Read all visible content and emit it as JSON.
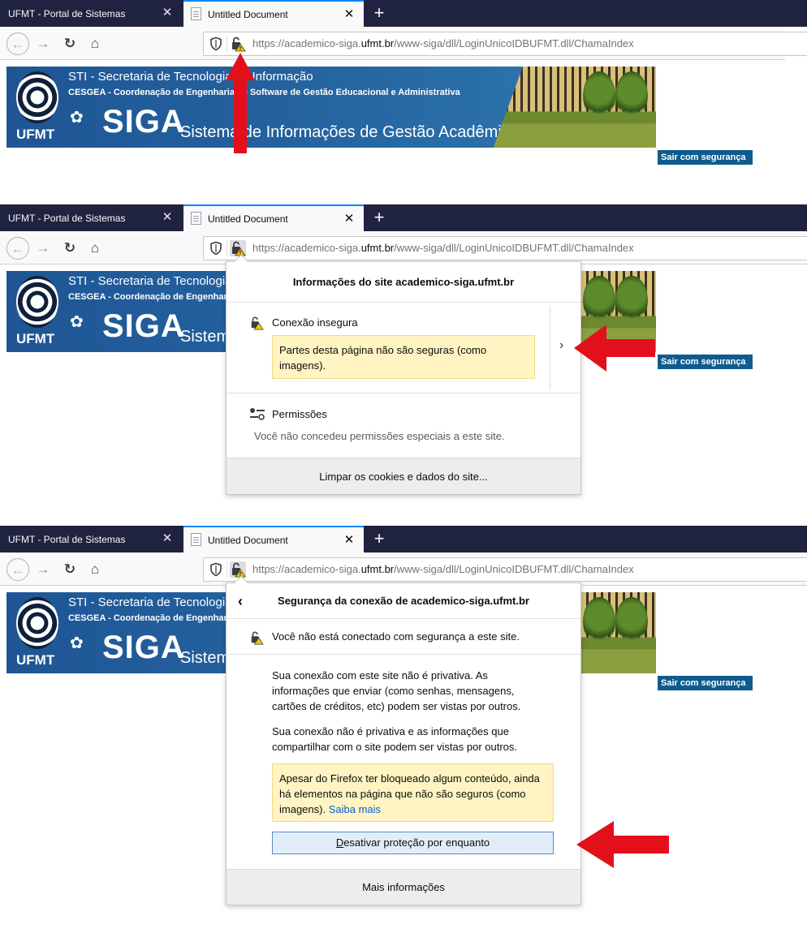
{
  "browser": {
    "tabs": [
      {
        "label": "UFMT - Portal de Sistemas",
        "close": "✕"
      },
      {
        "label": "Untitled Document",
        "close": "✕"
      }
    ],
    "new_tab": "+",
    "url_prefix": "https://academico-siga.",
    "url_host": "ufmt.br",
    "url_path": "/www-siga/dll/LoginUnicoIDBUFMT.dll/ChamaIndex"
  },
  "banner": {
    "sti": "STI - Secretaria de Tecnologia da Informação",
    "cesgea": "CESGEA - Coordenação de Engenharia de Software de Gestão  Educacional e Administrativa",
    "siga": "SIGA",
    "sistema": "Sistema de Informações de Gestão Acadêmica",
    "ufmt": "UFMT",
    "sair": "Sair com segurança"
  },
  "panel1": {
    "title": "Informações do site academico-siga.ufmt.br",
    "connection_label": "Conexão insegura",
    "connection_warning": "Partes desta página não são seguras (como imagens).",
    "permissions_label": "Permissões",
    "permissions_text": "Você não concedeu permissões especiais a este site.",
    "clear_button": "Limpar os cookies e dados do site..."
  },
  "panel2": {
    "title": "Segurança da conexão de academico-siga.ufmt.br",
    "status": "Você não está conectado com segurança a este site.",
    "para1": "Sua conexão com este site não é privativa. As informações que enviar (como senhas, mensagens, cartões de créditos, etc) podem ser vistas por outros.",
    "para2": "Sua conexão não é privativa e as informações que compartilhar com o site podem ser vistas por outros.",
    "warning": "Apesar do Firefox ter bloqueado algum conteúdo, ainda há elementos na página que não são seguros (como imagens).",
    "learn_more": "Saiba mais",
    "disable_prefix": "D",
    "disable_rest": "esativar proteção por enquanto",
    "more_info": "Mais informações"
  },
  "colors": {
    "tabbar": "#202340",
    "accent": "#0a84ff",
    "warning_bg": "#fff4c2",
    "arrow": "#e3101b",
    "sair_bg": "#0e5c8e"
  }
}
